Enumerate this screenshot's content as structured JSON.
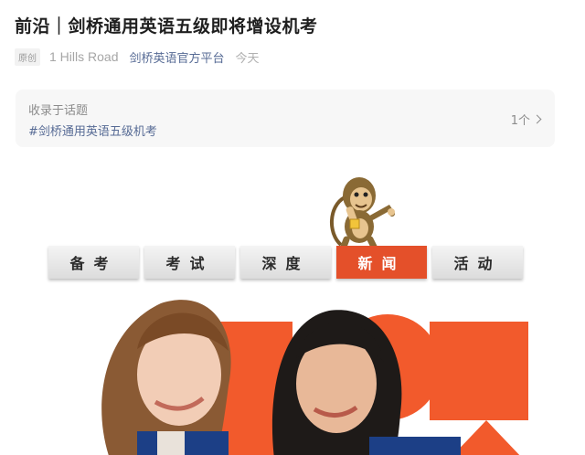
{
  "article": {
    "title": "前沿｜剑桥通用英语五级即将增设机考",
    "badge": "原创",
    "author": "1 Hills Road",
    "account": "剑桥英语官方平台",
    "date": "今天"
  },
  "topic": {
    "label": "收录于话题",
    "tag": "#剑桥通用英语五级机考",
    "count": "1个"
  },
  "banner": {
    "nav": [
      "备考",
      "考试",
      "深度",
      "新闻",
      "活动"
    ],
    "active_index": 3,
    "colors": {
      "accent": "#e4502a",
      "link": "#576b95"
    }
  }
}
